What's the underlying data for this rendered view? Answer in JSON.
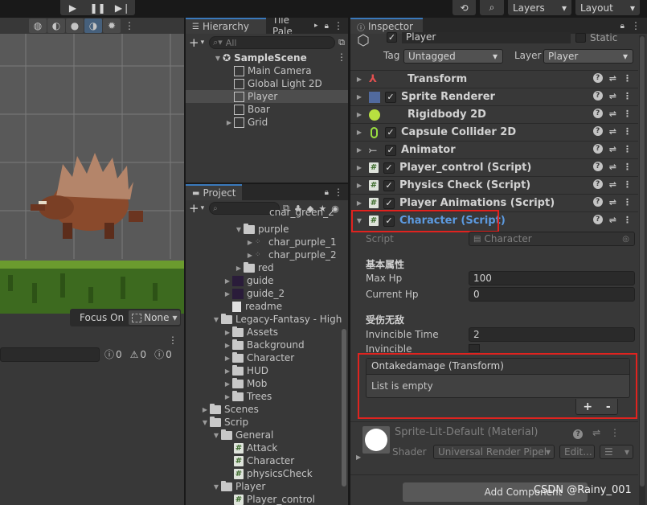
{
  "toolbar": {
    "play_icon": "play-icon",
    "pause_icon": "pause-icon",
    "step_icon": "step-icon",
    "layers": "Layers",
    "layout": "Layout"
  },
  "scene": {
    "focus_on_label": "Focus On",
    "focus_value": "None",
    "counts": [
      "0",
      "0",
      "0"
    ]
  },
  "hierarchy": {
    "tab": "Hierarchy",
    "tab2": "Tile Pale",
    "search_placeholder": "All",
    "scene_name": "SampleScene",
    "items": [
      "Main Camera",
      "Global Light 2D",
      "Player",
      "Boar",
      "Grid"
    ]
  },
  "project": {
    "tab": "Project",
    "items": [
      {
        "label": "char_green_2"
      },
      {
        "label": "purple"
      },
      {
        "label": "char_purple_1"
      },
      {
        "label": "char_purple_2"
      },
      {
        "label": "red"
      },
      {
        "label": "guide"
      },
      {
        "label": "guide_2"
      },
      {
        "label": "readme"
      },
      {
        "label": "Legacy-Fantasy - High"
      },
      {
        "label": "Assets"
      },
      {
        "label": "Background"
      },
      {
        "label": "Character"
      },
      {
        "label": "HUD"
      },
      {
        "label": "Mob"
      },
      {
        "label": "Trees"
      },
      {
        "label": "Scenes"
      },
      {
        "label": "Scrip"
      },
      {
        "label": "General"
      },
      {
        "label": "Attack"
      },
      {
        "label": "Character"
      },
      {
        "label": "physicsCheck"
      },
      {
        "label": "Player"
      },
      {
        "label": "Player_control"
      }
    ]
  },
  "inspector": {
    "tab": "Inspector",
    "object_name": "Player",
    "static_label": "Static",
    "tag_label": "Tag",
    "tag_value": "Untagged",
    "layer_label": "Layer",
    "layer_value": "Player",
    "components": [
      "Transform",
      "Sprite Renderer",
      "Rigidbody 2D",
      "Capsule Collider 2D",
      "Animator",
      "Player_control (Script)",
      "Physics Check (Script)",
      "Player Animations (Script)",
      "Character (Script)"
    ],
    "script_label": "Script",
    "script_value": "Character",
    "section1": "基本属性",
    "max_hp_label": "Max Hp",
    "max_hp_value": "100",
    "current_hp_label": "Current Hp",
    "current_hp_value": "0",
    "section2": "受伤无敌",
    "invincible_time_label": "Invincible Time",
    "invincible_time_value": "2",
    "invincible_label": "Invincible",
    "event_title": "Ontakedamage (Transform)",
    "event_empty": "List is empty",
    "plus": "+",
    "minus": "-",
    "material_name": "Sprite-Lit-Default (Material)",
    "shader_label": "Shader",
    "shader_value": "Universal Render Pipeli",
    "edit_label": "Edit...",
    "add_component": "Add Component",
    "watermark": "CSDN @Rainy_001"
  }
}
